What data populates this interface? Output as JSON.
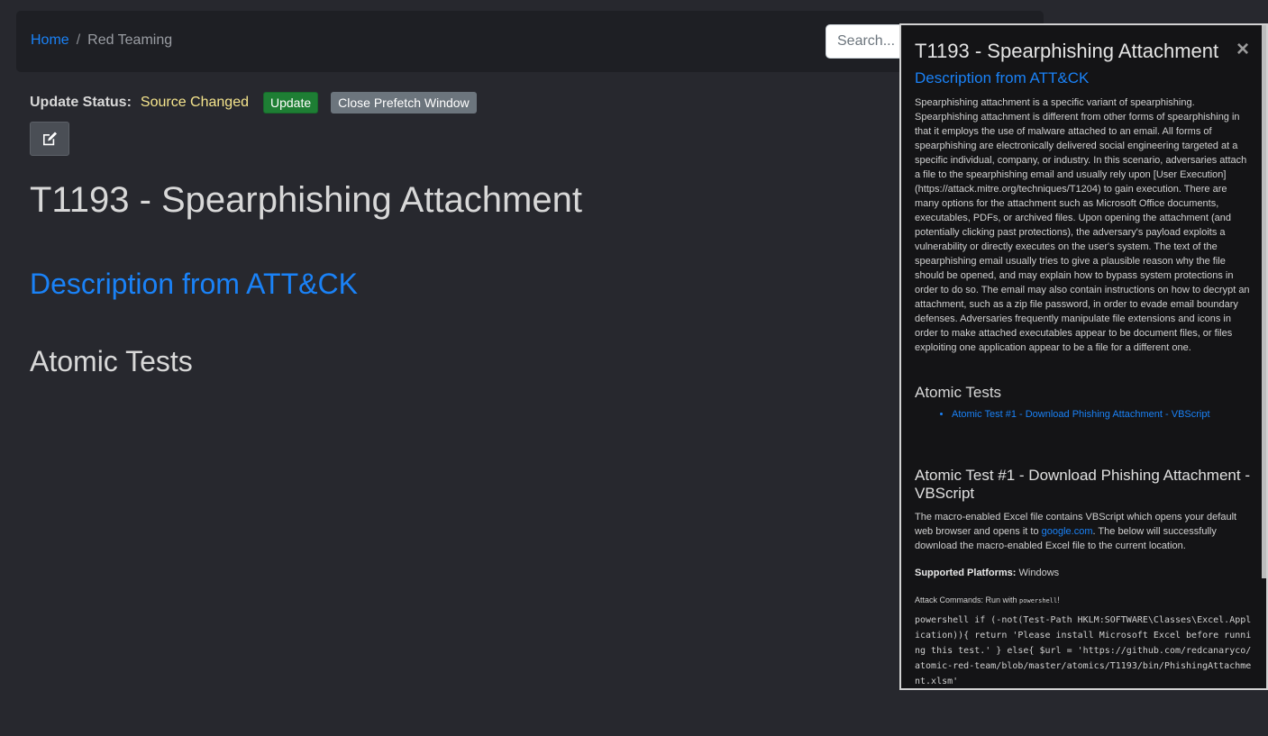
{
  "breadcrumb": {
    "home": "Home",
    "separator": "/",
    "current": "Red Teaming"
  },
  "search": {
    "placeholder": "Search..."
  },
  "status": {
    "label": "Update Status:",
    "value": "Source Changed",
    "update_button": "Update",
    "close_prefetch_button": "Close Prefetch Window"
  },
  "edit_icon": "edit-icon",
  "main": {
    "title": "T1193 - Spearphishing Attachment",
    "description_heading": "Description from ATT&CK",
    "atomic_heading": "Atomic Tests"
  },
  "prefetch": {
    "title": "T1193 - Spearphishing Attachment",
    "close": "×",
    "description_heading": "Description from ATT&CK",
    "description": "Spearphishing attachment is a specific variant of spearphishing. Spearphishing attachment is different from other forms of spearphishing in that it employs the use of malware attached to an email. All forms of spearphishing are electronically delivered social engineering targeted at a specific individual, company, or industry. In this scenario, adversaries attach a file to the spearphishing email and usually rely upon [User Execution](https://attack.mitre.org/techniques/T1204) to gain execution. There are many options for the attachment such as Microsoft Office documents, executables, PDFs, or archived files. Upon opening the attachment (and potentially clicking past protections), the adversary's payload exploits a vulnerability or directly executes on the user's system. The text of the spearphishing email usually tries to give a plausible reason why the file should be opened, and may explain how to bypass system protections in order to do so. The email may also contain instructions on how to decrypt an attachment, such as a zip file password, in order to evade email boundary defenses. Adversaries frequently manipulate file extensions and icons in order to make attached executables appear to be document files, or files exploiting one application appear to be a file for a different one.",
    "atomic_heading": "Atomic Tests",
    "test_links": [
      "Atomic Test #1 - Download Phishing Attachment - VBScript"
    ],
    "test_heading": "Atomic Test #1 - Download Phishing Attachment - VBScript",
    "test_desc_before": "The macro-enabled Excel file contains VBScript which opens your default web browser and opens it to ",
    "test_desc_link": "google.com",
    "test_desc_after": ". The below will successfully download the macro-enabled Excel file to the current location.",
    "platforms_label": "Supported Platforms:",
    "platforms_value": "Windows",
    "attack_label": "Attack Commands: Run with ",
    "attack_runner": "powershell",
    "attack_suffix": "!",
    "code": "powershell if (-not(Test-Path HKLM:SOFTWARE\\Classes\\Excel.Application)){ return 'Please install Microsoft Excel before running this test.' } else{ $url = 'https://github.com/redcanaryco/atomic-red-team/blob/master/atomics/T1193/bin/PhishingAttachment.xlsm'"
  },
  "colors": {
    "background": "#27282e",
    "navbar": "#1e1f24",
    "link": "#1a82f7",
    "status_value": "#f6e58d",
    "update_button": "#1e7e34",
    "secondary_button": "#6c757d"
  }
}
